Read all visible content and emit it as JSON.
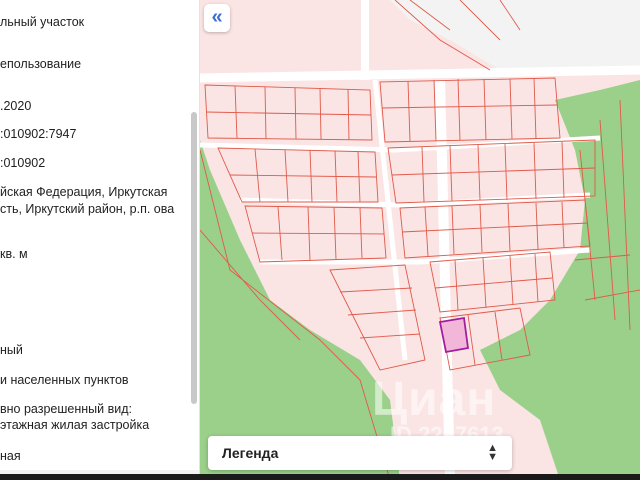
{
  "panel": {
    "rows": [
      "льный участок",
      "епользование",
      ".2020",
      ":010902:7947",
      ":010902",
      "йская Федерация, Иркутская сть, Иркутский район, р.п. ова",
      "кв. м",
      "ный",
      "и населенных пунктов",
      "вно разрешенный вид:",
      "этажная жилая застройка",
      "ная"
    ]
  },
  "map": {
    "collapse_icon": "«",
    "legend_label": "Легенда",
    "legend_chevron_up": "▲",
    "legend_chevron_down": "▼",
    "watermark_brand": "Циан",
    "watermark_id": "ID 2257613",
    "colors": {
      "parcel_fill": "#fbe4e4",
      "parcel_stroke": "#e05a4a",
      "green_zone": "#9ad08a",
      "road": "#ffffff",
      "selected_fill": "#f2b6d8",
      "selected_stroke": "#a01fa0"
    }
  }
}
